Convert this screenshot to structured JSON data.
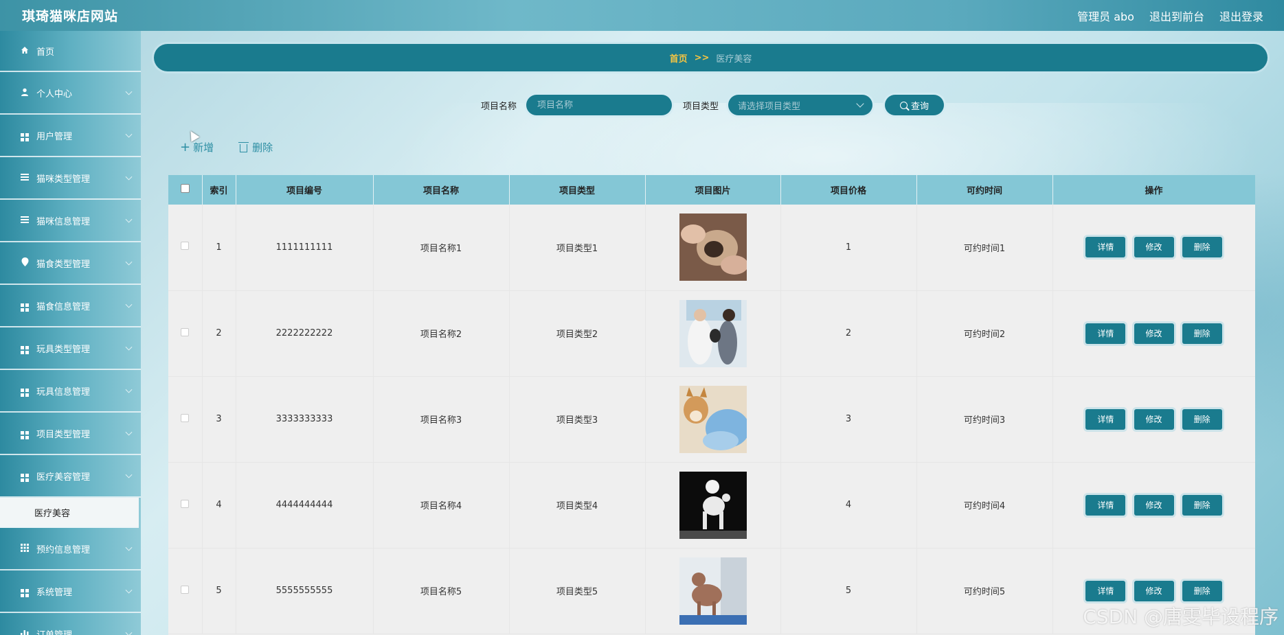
{
  "app": {
    "title": "琪琦猫咪店网站",
    "admin_label": "管理员 abo",
    "to_front": "退出到前台",
    "logout": "退出登录"
  },
  "sidebar": {
    "items": [
      {
        "label": "首页",
        "icon": "home-icon"
      },
      {
        "label": "个人中心",
        "icon": "user-icon"
      },
      {
        "label": "用户管理",
        "icon": "grid-icon"
      },
      {
        "label": "猫咪类型管理",
        "icon": "list-icon"
      },
      {
        "label": "猫咪信息管理",
        "icon": "list-icon"
      },
      {
        "label": "猫食类型管理",
        "icon": "location-icon"
      },
      {
        "label": "猫食信息管理",
        "icon": "grid-icon"
      },
      {
        "label": "玩具类型管理",
        "icon": "grid-icon"
      },
      {
        "label": "玩具信息管理",
        "icon": "grid-icon"
      },
      {
        "label": "项目类型管理",
        "icon": "grid-icon"
      },
      {
        "label": "医疗美容管理",
        "icon": "grid-icon"
      },
      {
        "label": "预约信息管理",
        "icon": "grid-icon"
      },
      {
        "label": "系统管理",
        "icon": "grid-icon"
      },
      {
        "label": "订单管理",
        "icon": "chart-icon"
      }
    ],
    "active_sub": "医疗美容"
  },
  "breadcrumb": {
    "home": "首页",
    "sep": ">>",
    "current": "医疗美容"
  },
  "search": {
    "name_label": "项目名称",
    "name_placeholder": "项目名称",
    "type_label": "项目类型",
    "type_placeholder": "请选择项目类型",
    "query": "查询"
  },
  "actions": {
    "add": "新增",
    "delete": "删除"
  },
  "table": {
    "headers": [
      "索引",
      "项目编号",
      "项目名称",
      "项目类型",
      "项目图片",
      "项目价格",
      "可约时间",
      "操作"
    ],
    "rows": [
      {
        "index": "1",
        "code": "1111111111",
        "name": "项目名称1",
        "type": "项目类型1",
        "price": "1",
        "time": "可约时间1"
      },
      {
        "index": "2",
        "code": "2222222222",
        "name": "项目名称2",
        "type": "项目类型2",
        "price": "2",
        "time": "可约时间2"
      },
      {
        "index": "3",
        "code": "3333333333",
        "name": "项目名称3",
        "type": "项目类型3",
        "price": "3",
        "time": "可约时间3"
      },
      {
        "index": "4",
        "code": "4444444444",
        "name": "项目名称4",
        "type": "项目类型4",
        "price": "4",
        "time": "可约时间4"
      },
      {
        "index": "5",
        "code": "5555555555",
        "name": "项目名称5",
        "type": "项目类型5",
        "price": "5",
        "time": "可约时间5"
      }
    ],
    "row_buttons": {
      "detail": "详情",
      "edit": "修改",
      "delete": "删除"
    }
  },
  "watermark": "CSDN @唐雯毕设程序",
  "colors": {
    "primary": "#1a7b8e",
    "header_row": "#84c7d6",
    "breadcrumb_accent": "#f5c542"
  }
}
